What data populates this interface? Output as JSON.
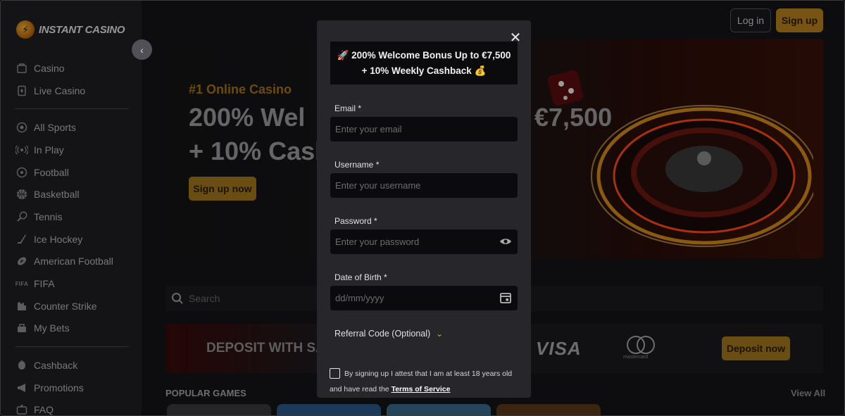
{
  "header": {
    "brand": "INSTANT CASINO",
    "login_label": "Log in",
    "signup_label": "Sign up"
  },
  "sidebar": {
    "group1": [
      {
        "label": "Casino",
        "icon": "casino-icon"
      },
      {
        "label": "Live Casino",
        "icon": "live-casino-icon"
      }
    ],
    "group2": [
      {
        "label": "All Sports",
        "icon": "all-sports-icon"
      },
      {
        "label": "In Play",
        "icon": "in-play-icon"
      },
      {
        "label": "Football",
        "icon": "football-icon"
      },
      {
        "label": "Basketball",
        "icon": "basketball-icon"
      },
      {
        "label": "Tennis",
        "icon": "tennis-icon"
      },
      {
        "label": "Ice Hockey",
        "icon": "ice-hockey-icon"
      },
      {
        "label": "American Football",
        "icon": "american-football-icon"
      },
      {
        "label": "FIFA",
        "icon": "fifa-icon"
      },
      {
        "label": "Counter Strike",
        "icon": "counter-strike-icon"
      },
      {
        "label": "My Bets",
        "icon": "my-bets-icon"
      }
    ],
    "group3": [
      {
        "label": "Cashback",
        "icon": "cashback-icon"
      },
      {
        "label": "Promotions",
        "icon": "promotions-icon"
      },
      {
        "label": "FAQ",
        "icon": "faq-icon"
      }
    ],
    "fifa_icon_text": "FIFA"
  },
  "hero": {
    "kicker": "#1 Online Casino",
    "title_line1": "200% Wel",
    "title_line2": "+ 10% Casl",
    "title_amount": "€7,500",
    "cta_label": "Sign up now"
  },
  "search": {
    "placeholder": "Search"
  },
  "deposit_banner": {
    "text": "DEPOSIT WITH SA",
    "visa": "VISA",
    "mastercard": "mastercard",
    "cta_label": "Deposit now"
  },
  "sections": {
    "popular_games": "POPULAR GAMES",
    "view_all": "View All"
  },
  "modal": {
    "promo_line1": "200% Welcome Bonus Up to €7,500",
    "promo_line2": "+ 10% Weekly Cashback",
    "promo_icon1": "🚀",
    "promo_icon2": "💰",
    "email_label": "Email *",
    "email_placeholder": "Enter your email",
    "username_label": "Username *",
    "username_placeholder": "Enter your username",
    "password_label": "Password *",
    "password_placeholder": "Enter your password",
    "dob_label": "Date of Birth *",
    "dob_placeholder": "dd/mm/yyyy",
    "referral_label": "Referral Code (Optional)",
    "terms_line1": "By signing up I attest that I am at least 18 years old",
    "terms_line2_prefix": "and have read the ",
    "terms_link": "Terms of Service"
  },
  "colors": {
    "accent": "#b8821f",
    "sidebar_bg": "#202024",
    "modal_bg": "#26262b",
    "field_bg": "#0b0b0d"
  }
}
